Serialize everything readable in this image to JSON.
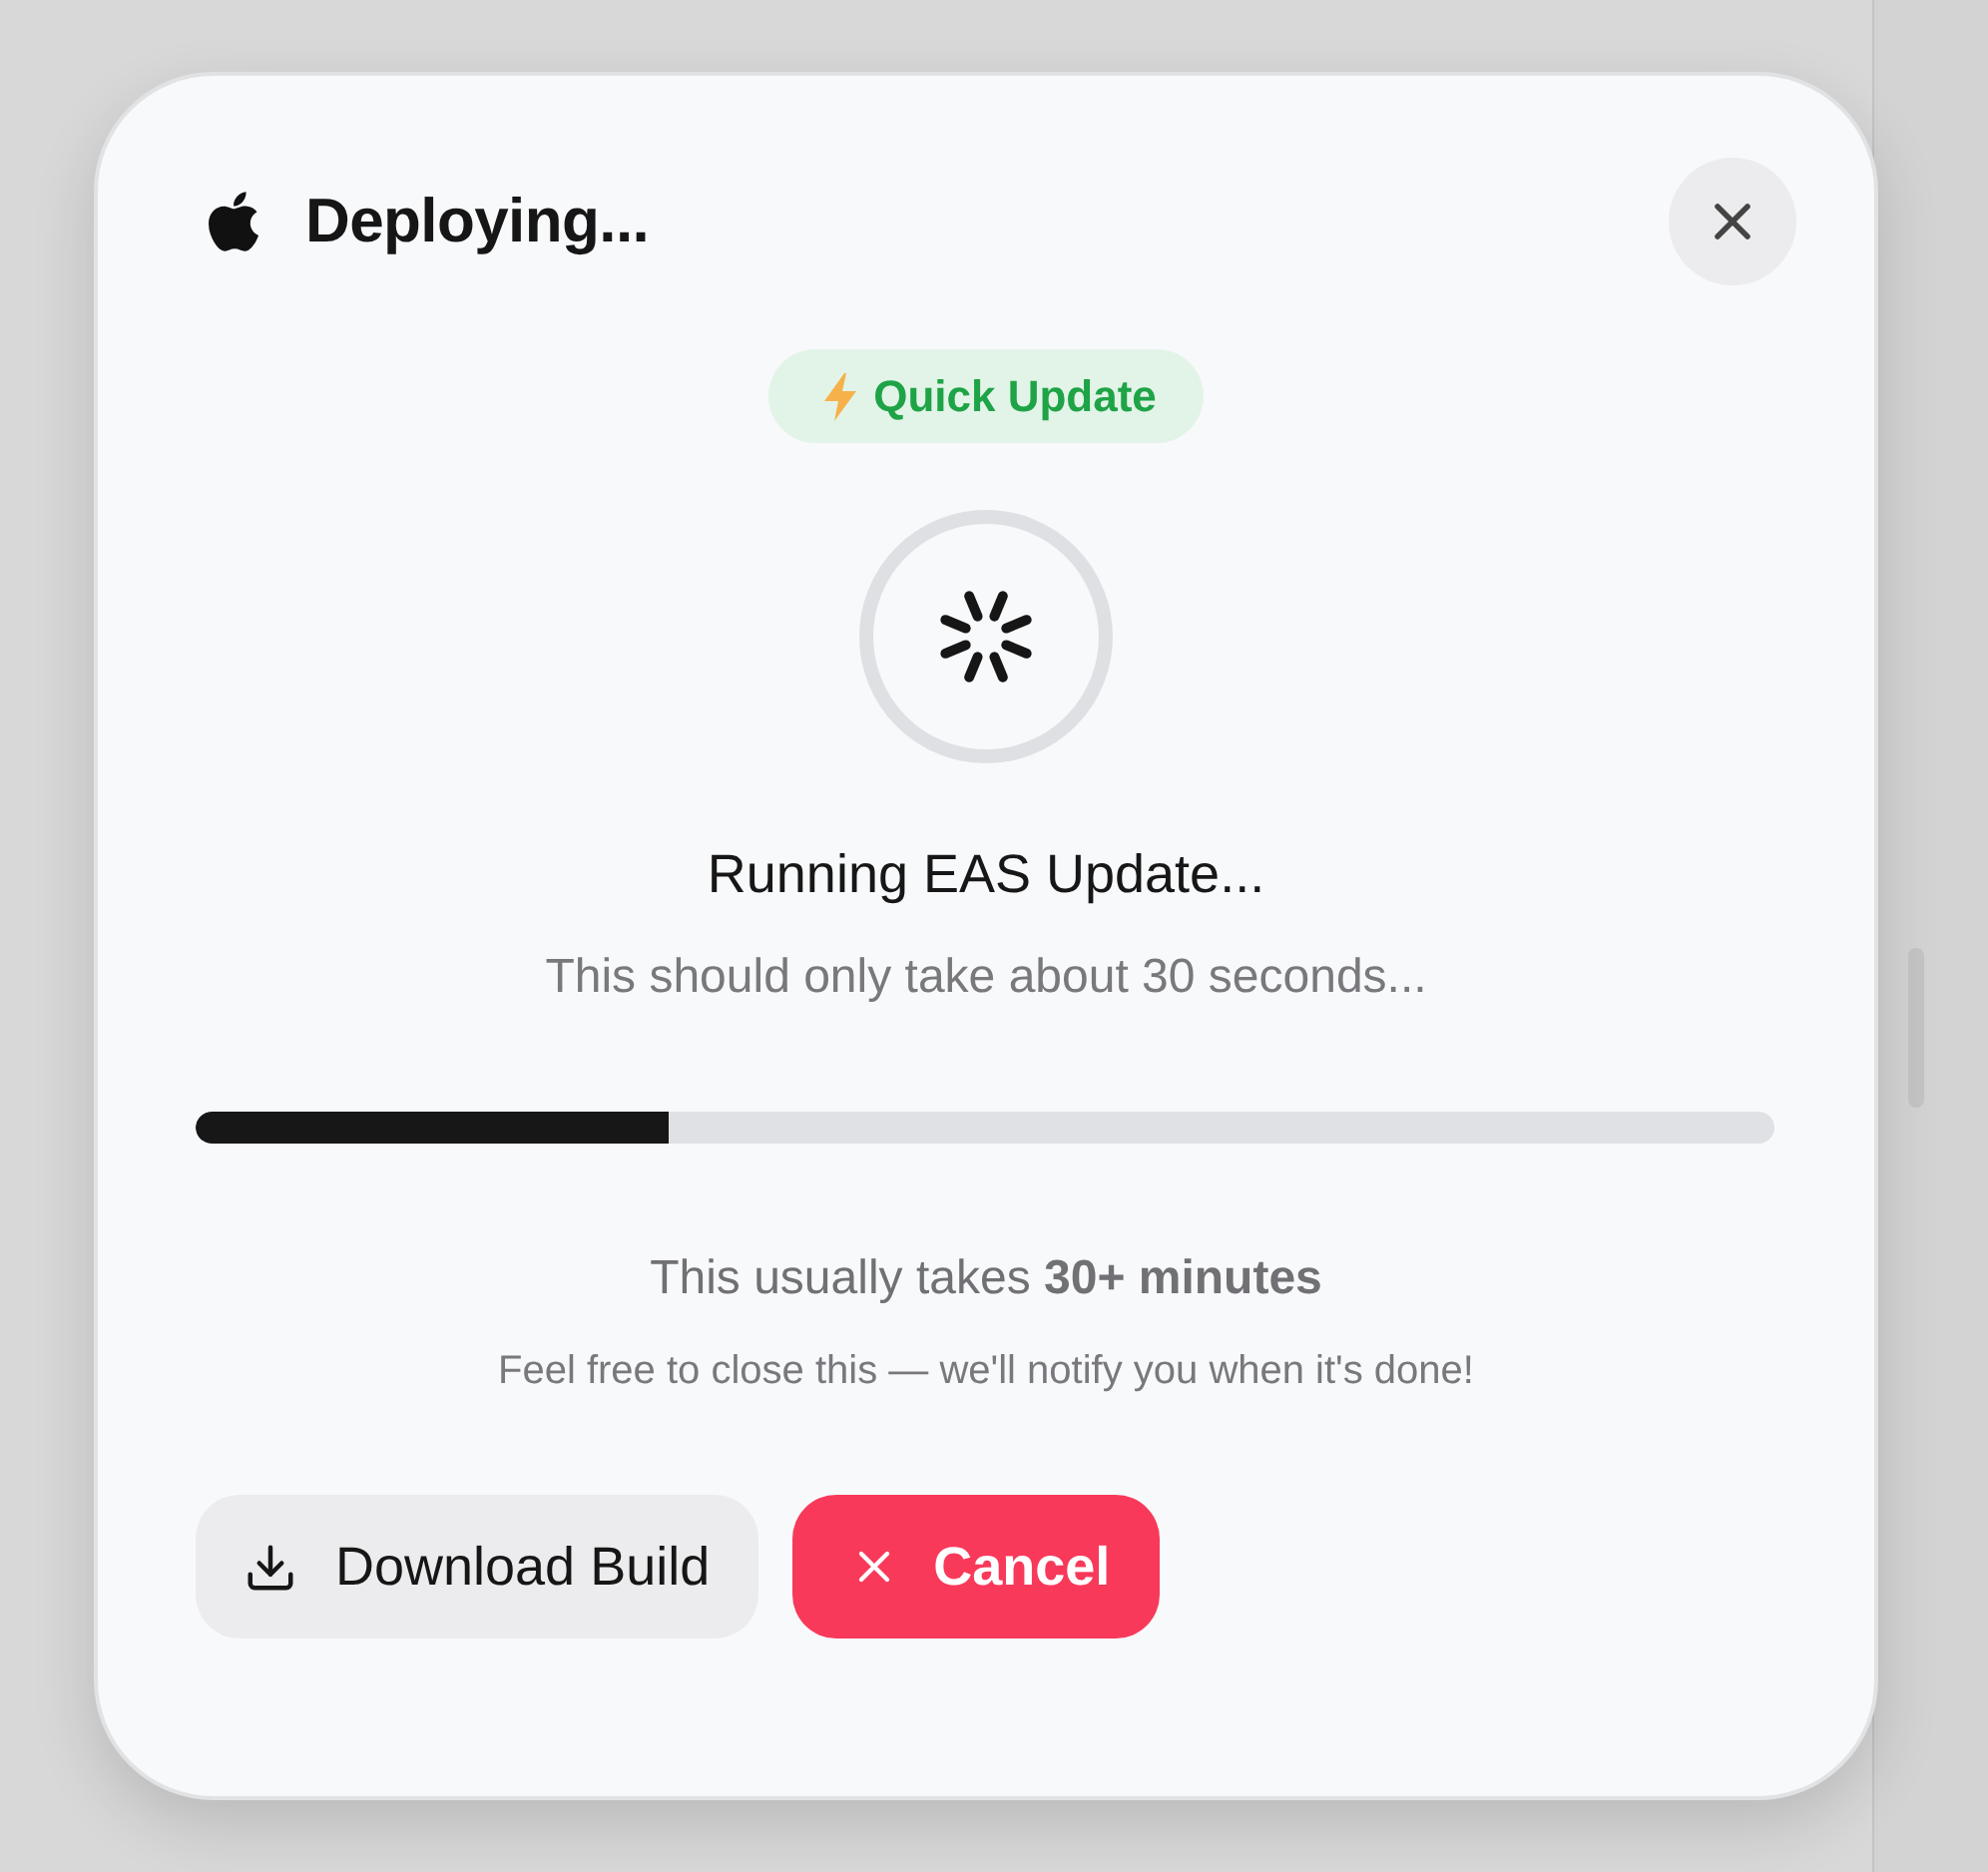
{
  "dialog": {
    "title": "Deploying..."
  },
  "badge": {
    "label": "Quick Update"
  },
  "status": {
    "heading": "Running EAS Update...",
    "subheading": "This should only take about 30 seconds..."
  },
  "progress": {
    "level": 0.3
  },
  "info": {
    "estimate": "This usually takes **30+ minutes**",
    "hint": "Feel free to close this — we'll notify you when it's done!"
  },
  "buttons": [
    {
      "label": "Download Build",
      "kind": "download"
    },
    {
      "label": "Cancel",
      "kind": "cancel"
    }
  ]
}
